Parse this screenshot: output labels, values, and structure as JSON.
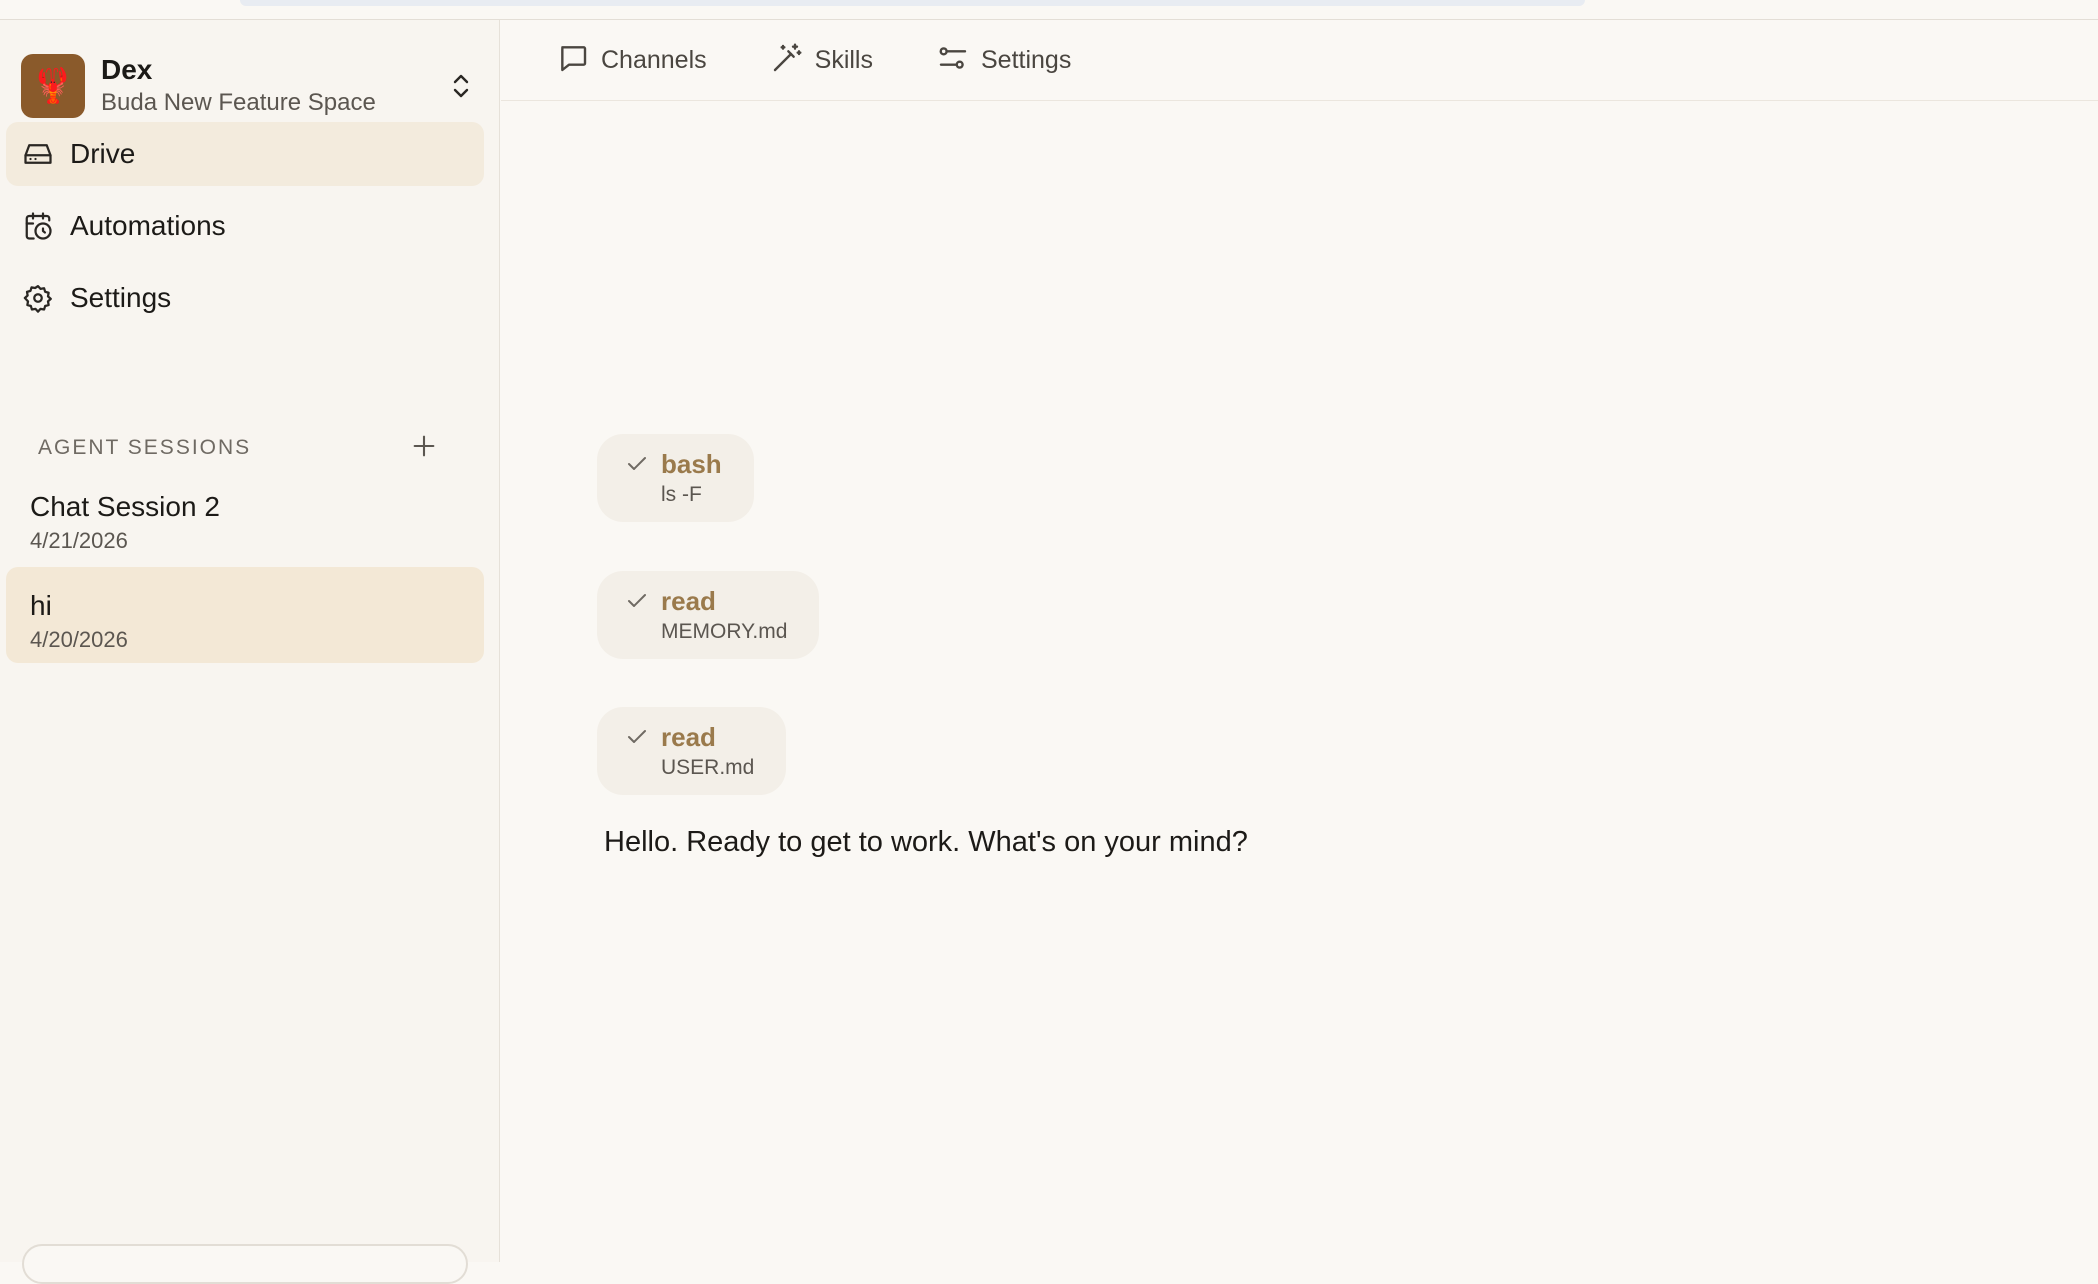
{
  "workspace": {
    "name": "Dex",
    "space": "Buda New Feature Space"
  },
  "nav": {
    "items": [
      {
        "label": "Drive",
        "icon": "drive-icon",
        "active": true
      },
      {
        "label": "Automations",
        "icon": "calendar-clock-icon",
        "active": false
      },
      {
        "label": "Settings",
        "icon": "gear-icon",
        "active": false
      }
    ]
  },
  "sessions": {
    "header": "AGENT SESSIONS",
    "items": [
      {
        "title": "Chat Session 2",
        "date": "4/21/2026",
        "active": false
      },
      {
        "title": "hi",
        "date": "4/20/2026",
        "active": true
      }
    ]
  },
  "tabs": [
    {
      "label": "Channels",
      "icon": "chat-bubble-icon"
    },
    {
      "label": "Skills",
      "icon": "magic-wand-icon"
    },
    {
      "label": "Settings",
      "icon": "sliders-icon"
    }
  ],
  "conversation": {
    "tool_calls": [
      {
        "tool": "bash",
        "arg": "ls -F",
        "status": "done"
      },
      {
        "tool": "read",
        "arg": "MEMORY.md",
        "status": "done"
      },
      {
        "tool": "read",
        "arg": "USER.md",
        "status": "done"
      }
    ],
    "reply": "Hello. Ready to get to work. What's on your mind?"
  },
  "colors": {
    "active_nav_bg": "#f3ebdd",
    "active_session_bg": "#f3e8d6",
    "tool_name": "#9a7a4c",
    "chip_bg": "#f3efe8",
    "avatar_bg": "#8a5a2b"
  }
}
